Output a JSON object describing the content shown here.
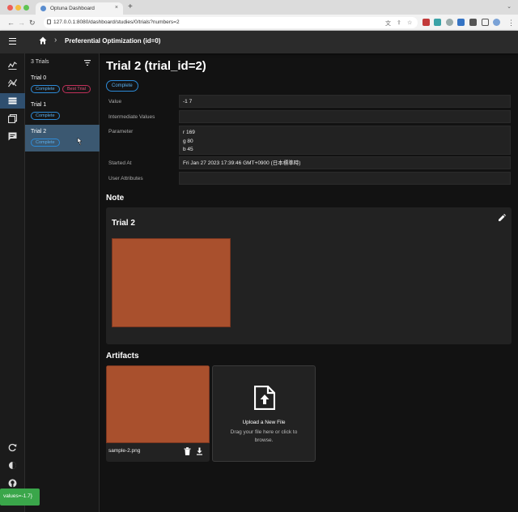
{
  "browser": {
    "tab_title": "Optuna Dashboard",
    "tab_close": "×",
    "new_tab": "+",
    "url": "127.0.0.1:8080/dashboard/studies/0/trials?numbers=2"
  },
  "appbar": {
    "breadcrumb_separator": "›",
    "study_title": "Preferential Optimization (id=0)"
  },
  "trial_list": {
    "header": "3 Trials",
    "items": [
      {
        "name": "Trial 0",
        "chips": [
          "Complete",
          "Best Trial"
        ]
      },
      {
        "name": "Trial 1",
        "chips": [
          "Complete"
        ]
      },
      {
        "name": "Trial 2",
        "chips": [
          "Complete"
        ]
      }
    ]
  },
  "detail": {
    "title": "Trial 2 (trial_id=2)",
    "state": "Complete",
    "fields": [
      {
        "label": "Value",
        "lines": [
          "-1 7"
        ]
      },
      {
        "label": "Intermediate Values",
        "lines": [
          ""
        ]
      },
      {
        "label": "Parameter",
        "lines": [
          "r 169",
          "g 80",
          "b 45"
        ]
      },
      {
        "label": "Started At",
        "lines": [
          "Fri Jan 27 2023 17:39:46 GMT+0900 (日本標準時)"
        ]
      },
      {
        "label": "User Attributes",
        "lines": [
          ""
        ]
      }
    ],
    "note_section": "Note",
    "note_title": "Trial 2",
    "artifacts_section": "Artifacts",
    "artifact_file": "sample-2.png",
    "upload_title": "Upload a New File",
    "upload_hint": "Drag your file here or click to browse."
  },
  "toast_text": "values=-1.7}",
  "colors": {
    "accent_blue": "#2d8bd8",
    "best_trial_red": "#c2305a",
    "selected_row": "#3b5871",
    "artifact_color": "#a9502d",
    "toast_green": "#3aa64a"
  },
  "icons": [
    "hamburger-icon",
    "home-icon",
    "chart-icon",
    "analytics-icon",
    "list-icon",
    "table-icon",
    "note-icon",
    "reload-icon",
    "theme-icon",
    "github-icon",
    "filter-icon",
    "edit-icon",
    "trash-icon",
    "download-icon",
    "upload-file-icon"
  ]
}
